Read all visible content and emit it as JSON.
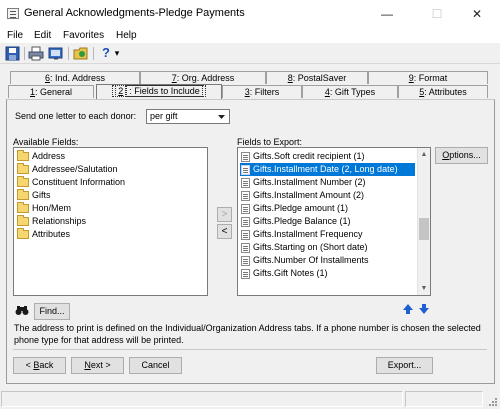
{
  "window": {
    "title": "General Acknowledgments-Pledge Payments",
    "icon": "report-icon",
    "minimize_glyph": "—",
    "maximize_glyph": "☐",
    "close_glyph": "✕"
  },
  "menu": [
    "File",
    "Edit",
    "Favorites",
    "Help"
  ],
  "toolbar": {
    "icons": [
      "save-icon",
      "print-icon",
      "export-icon",
      "folder-icon",
      "help-icon"
    ],
    "help_glyph": "?",
    "dropdown_glyph": "▾"
  },
  "tabs": {
    "back_row": [
      {
        "num": "6",
        "label": ": Ind. Address"
      },
      {
        "num": "7",
        "label": ": Org. Address"
      },
      {
        "num": "8",
        "label": ": PostalSaver"
      },
      {
        "num": "9",
        "label": ": Format"
      }
    ],
    "front_row": [
      {
        "num": "1",
        "label": ": General"
      },
      {
        "num": "2",
        "label": ": Fields to Include",
        "active": true
      },
      {
        "num": "3",
        "label": ": Filters"
      },
      {
        "num": "4",
        "label": ": Gift Types"
      },
      {
        "num": "5",
        "label": ": Attributes"
      }
    ]
  },
  "send_letter": {
    "label": "Send one letter to each donor:",
    "value": "per gift"
  },
  "available_fields": {
    "label": "Available Fields:",
    "items": [
      "Address",
      "Addressee/Salutation",
      "Constituent Information",
      "Gifts",
      "Hon/Mem",
      "Relationships",
      "Attributes"
    ]
  },
  "fields_to_export": {
    "label": "Fields to Export:",
    "items": [
      "Gifts.Soft credit recipient (1)",
      "Gifts.Installment Date (2, Long date)",
      "Gifts.Installment Number (2)",
      "Gifts.Installment Amount (2)",
      "Gifts.Pledge amount (1)",
      "Gifts.Pledge Balance (1)",
      "Gifts.Installment Frequency",
      "Gifts.Starting on (Short date)",
      "Gifts.Number Of Installments",
      "Gifts.Gift Notes (1)"
    ],
    "selected_index": 1
  },
  "buttons": {
    "add": ">",
    "remove": "<",
    "options": "Options...",
    "find": "Find...",
    "back": "Back",
    "next": "Next",
    "cancel": "Cancel",
    "export": "Export..."
  },
  "help_text": "The address to print is defined on the Individual/Organization Address tabs. If a phone number is chosen the selected phone type for that address will be printed.",
  "colors": {
    "selection": "#0078d7",
    "folder": "#f6d66e",
    "arrow_blue": "#1e5fd4"
  }
}
